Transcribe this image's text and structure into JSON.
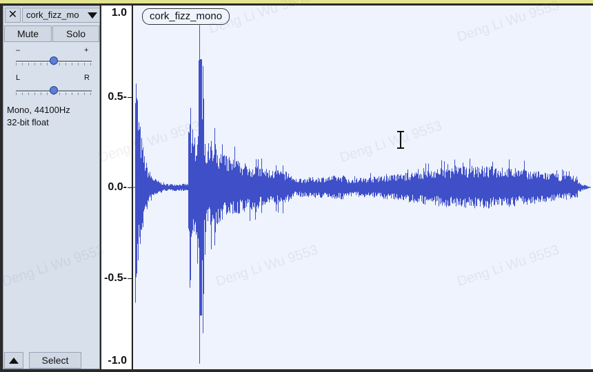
{
  "track": {
    "close_label": "✕",
    "name": "cork_fizz_mo",
    "mute_label": "Mute",
    "solo_label": "Solo",
    "gain": {
      "minus": "–",
      "plus": "+",
      "value": 0.5
    },
    "pan": {
      "left": "L",
      "right": "R",
      "value": 0.5
    },
    "format_line1": "Mono, 44100Hz",
    "format_line2": "32-bit float",
    "select_label": "Select"
  },
  "clip": {
    "name": "cork_fizz_mono"
  },
  "ruler": {
    "labels": [
      "1.0",
      "0.5-",
      "0.0-",
      "-0.5-",
      "-1.0"
    ],
    "values": [
      1.0,
      0.5,
      0.0,
      -0.5,
      -1.0
    ]
  },
  "watermark": "Deng Li Wu 9553",
  "colors": {
    "waveform": "#3f4fc8",
    "panel": "#d8e0ec",
    "wave_bg": "#eef3fd",
    "accent_top": "#e3e48f"
  }
}
